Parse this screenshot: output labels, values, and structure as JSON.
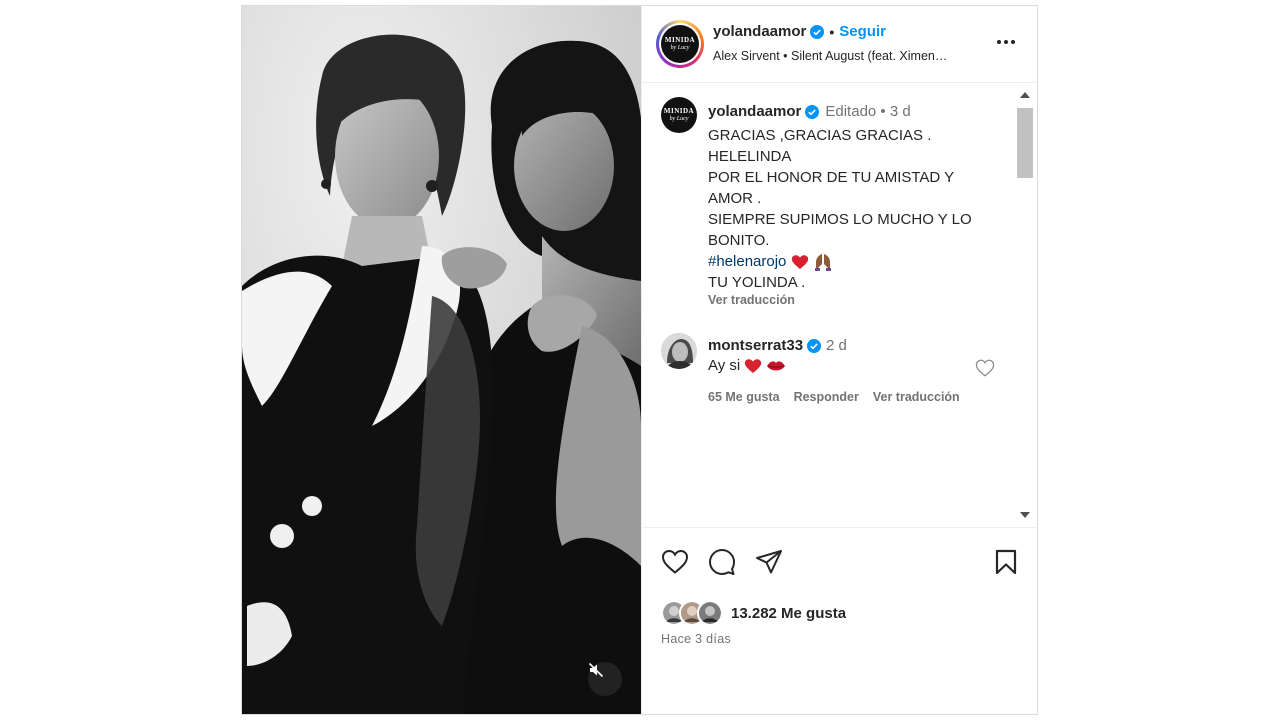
{
  "header": {
    "username": "yolandaamor",
    "follow_label": "Seguir",
    "separator": "•",
    "audio": "Alex Sirvent • Silent August (feat. Ximen…",
    "avatar_text_1": "MINIDA",
    "avatar_text_2": "by Lucy"
  },
  "caption": {
    "username": "yolandaamor",
    "meta": "Editado •  3 d",
    "lines": [
      "GRACIAS ,GRACIAS GRACIAS .",
      "HELELINDA",
      "POR EL HONOR DE TU AMISTAD Y",
      "AMOR .",
      "SIEMPRE SUPIMOS LO MUCHO Y LO",
      "BONITO."
    ],
    "hashtag": "#helenarojo",
    "signature": "TU YOLINDA .",
    "translate_label": "Ver traducción"
  },
  "comment": {
    "username": "montserrat33",
    "time": "2 d",
    "text": "Ay si",
    "likes": "65 Me gusta",
    "reply_label": "Responder",
    "translate_label": "Ver traducción"
  },
  "footer": {
    "likes_text": "13.282 Me gusta",
    "time_text": "Hace 3 días"
  },
  "colors": {
    "follow_blue": "#0095f6",
    "verified_blue": "#0095f6",
    "hashtag": "#00376b",
    "secondary_text": "#737373"
  },
  "icons": [
    "verified-badge-icon",
    "more-options-icon",
    "heart-icon",
    "comment-icon",
    "share-icon",
    "bookmark-icon",
    "mute-icon",
    "red-heart-emoji",
    "prayer-hands-emoji",
    "kiss-lips-emoji"
  ]
}
